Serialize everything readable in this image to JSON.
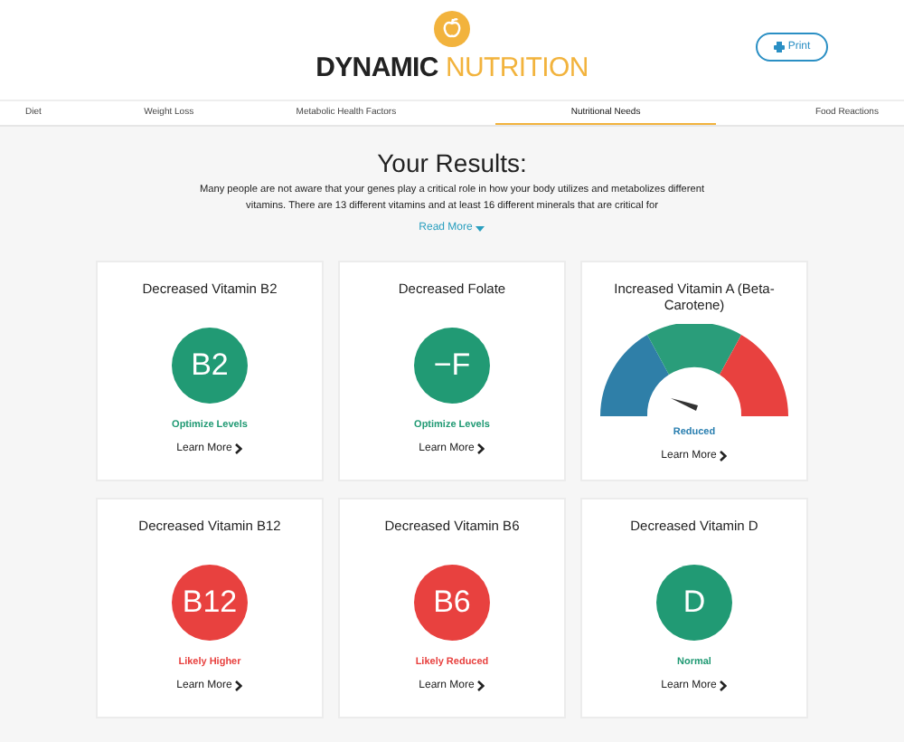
{
  "brand": {
    "name_dark": "DYNAMIC",
    "name_light": "NUTRITION"
  },
  "print_button": {
    "label": "Print"
  },
  "tabs": [
    {
      "label": "Diet",
      "selected": false
    },
    {
      "label": "Weight Loss",
      "selected": false
    },
    {
      "label": "Metabolic Health Factors",
      "selected": false
    },
    {
      "label": "Nutritional Needs",
      "selected": true
    },
    {
      "label": "Food Reactions",
      "selected": false
    }
  ],
  "results": {
    "heading": "Your Results:",
    "intro": "Many people are not aware that your genes play a critical role in how your body utilizes and metabolizes different vitamins. There are 13 different vitamins and at least 16 different minerals that are critical for",
    "read_more": "Read More"
  },
  "cards": [
    {
      "kind": "badge",
      "title": "Decreased Vitamin B2",
      "symbol": "B2",
      "color": "#219a74",
      "status": "Optimize Levels",
      "link": "Learn More"
    },
    {
      "kind": "badge",
      "title": "Decreased Folate",
      "symbol": "−F",
      "color": "#219a74",
      "status": "Optimize Levels",
      "link": "Learn More"
    },
    {
      "kind": "gauge",
      "title": "Increased Vitamin A (Beta-Carotene)",
      "status": "Reduced",
      "link": "Learn More"
    },
    {
      "kind": "badge",
      "title": "Decreased Vitamin B12",
      "symbol": "B12",
      "color": "#e8413f",
      "status": "Likely Higher",
      "link": "Learn More"
    },
    {
      "kind": "badge",
      "title": "Decreased Vitamin B6",
      "symbol": "B6",
      "color": "#e8413f",
      "status": "Likely Reduced",
      "link": "Learn More"
    },
    {
      "kind": "badge",
      "title": "Decreased Vitamin D",
      "symbol": "D",
      "color": "#219a74",
      "status": "Normal",
      "link": "Learn More"
    }
  ]
}
